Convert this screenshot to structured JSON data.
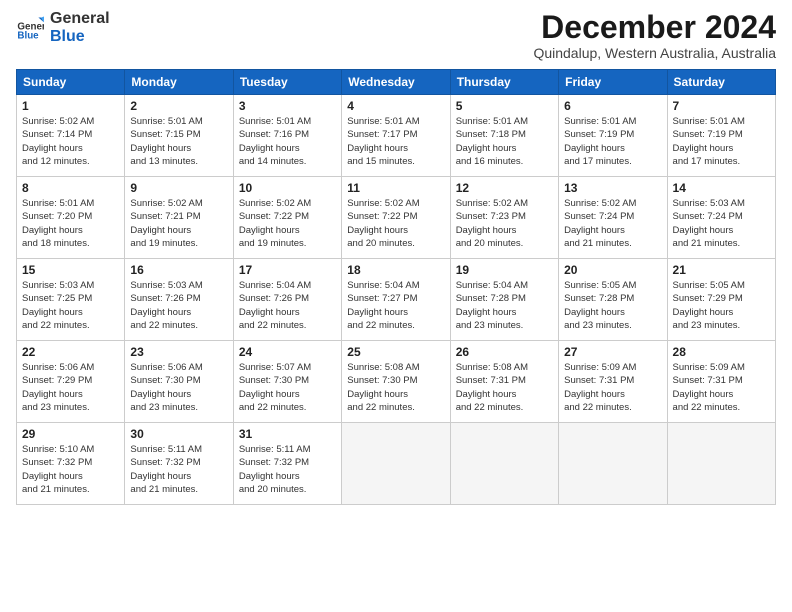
{
  "logo": {
    "general": "General",
    "blue": "Blue"
  },
  "title": "December 2024",
  "subtitle": "Quindalup, Western Australia, Australia",
  "days_of_week": [
    "Sunday",
    "Monday",
    "Tuesday",
    "Wednesday",
    "Thursday",
    "Friday",
    "Saturday"
  ],
  "weeks": [
    [
      {
        "day": "1",
        "sunrise": "5:02 AM",
        "sunset": "7:14 PM",
        "daylight": "14 hours and 12 minutes."
      },
      {
        "day": "2",
        "sunrise": "5:01 AM",
        "sunset": "7:15 PM",
        "daylight": "14 hours and 13 minutes."
      },
      {
        "day": "3",
        "sunrise": "5:01 AM",
        "sunset": "7:16 PM",
        "daylight": "14 hours and 14 minutes."
      },
      {
        "day": "4",
        "sunrise": "5:01 AM",
        "sunset": "7:17 PM",
        "daylight": "14 hours and 15 minutes."
      },
      {
        "day": "5",
        "sunrise": "5:01 AM",
        "sunset": "7:18 PM",
        "daylight": "14 hours and 16 minutes."
      },
      {
        "day": "6",
        "sunrise": "5:01 AM",
        "sunset": "7:19 PM",
        "daylight": "14 hours and 17 minutes."
      },
      {
        "day": "7",
        "sunrise": "5:01 AM",
        "sunset": "7:19 PM",
        "daylight": "14 hours and 17 minutes."
      }
    ],
    [
      {
        "day": "8",
        "sunrise": "5:01 AM",
        "sunset": "7:20 PM",
        "daylight": "14 hours and 18 minutes."
      },
      {
        "day": "9",
        "sunrise": "5:02 AM",
        "sunset": "7:21 PM",
        "daylight": "14 hours and 19 minutes."
      },
      {
        "day": "10",
        "sunrise": "5:02 AM",
        "sunset": "7:22 PM",
        "daylight": "14 hours and 19 minutes."
      },
      {
        "day": "11",
        "sunrise": "5:02 AM",
        "sunset": "7:22 PM",
        "daylight": "14 hours and 20 minutes."
      },
      {
        "day": "12",
        "sunrise": "5:02 AM",
        "sunset": "7:23 PM",
        "daylight": "14 hours and 20 minutes."
      },
      {
        "day": "13",
        "sunrise": "5:02 AM",
        "sunset": "7:24 PM",
        "daylight": "14 hours and 21 minutes."
      },
      {
        "day": "14",
        "sunrise": "5:03 AM",
        "sunset": "7:24 PM",
        "daylight": "14 hours and 21 minutes."
      }
    ],
    [
      {
        "day": "15",
        "sunrise": "5:03 AM",
        "sunset": "7:25 PM",
        "daylight": "14 hours and 22 minutes."
      },
      {
        "day": "16",
        "sunrise": "5:03 AM",
        "sunset": "7:26 PM",
        "daylight": "14 hours and 22 minutes."
      },
      {
        "day": "17",
        "sunrise": "5:04 AM",
        "sunset": "7:26 PM",
        "daylight": "14 hours and 22 minutes."
      },
      {
        "day": "18",
        "sunrise": "5:04 AM",
        "sunset": "7:27 PM",
        "daylight": "14 hours and 22 minutes."
      },
      {
        "day": "19",
        "sunrise": "5:04 AM",
        "sunset": "7:28 PM",
        "daylight": "14 hours and 23 minutes."
      },
      {
        "day": "20",
        "sunrise": "5:05 AM",
        "sunset": "7:28 PM",
        "daylight": "14 hours and 23 minutes."
      },
      {
        "day": "21",
        "sunrise": "5:05 AM",
        "sunset": "7:29 PM",
        "daylight": "14 hours and 23 minutes."
      }
    ],
    [
      {
        "day": "22",
        "sunrise": "5:06 AM",
        "sunset": "7:29 PM",
        "daylight": "14 hours and 23 minutes."
      },
      {
        "day": "23",
        "sunrise": "5:06 AM",
        "sunset": "7:30 PM",
        "daylight": "14 hours and 23 minutes."
      },
      {
        "day": "24",
        "sunrise": "5:07 AM",
        "sunset": "7:30 PM",
        "daylight": "14 hours and 22 minutes."
      },
      {
        "day": "25",
        "sunrise": "5:08 AM",
        "sunset": "7:30 PM",
        "daylight": "14 hours and 22 minutes."
      },
      {
        "day": "26",
        "sunrise": "5:08 AM",
        "sunset": "7:31 PM",
        "daylight": "14 hours and 22 minutes."
      },
      {
        "day": "27",
        "sunrise": "5:09 AM",
        "sunset": "7:31 PM",
        "daylight": "14 hours and 22 minutes."
      },
      {
        "day": "28",
        "sunrise": "5:09 AM",
        "sunset": "7:31 PM",
        "daylight": "14 hours and 22 minutes."
      }
    ],
    [
      {
        "day": "29",
        "sunrise": "5:10 AM",
        "sunset": "7:32 PM",
        "daylight": "14 hours and 21 minutes."
      },
      {
        "day": "30",
        "sunrise": "5:11 AM",
        "sunset": "7:32 PM",
        "daylight": "14 hours and 21 minutes."
      },
      {
        "day": "31",
        "sunrise": "5:11 AM",
        "sunset": "7:32 PM",
        "daylight": "14 hours and 20 minutes."
      },
      null,
      null,
      null,
      null
    ]
  ]
}
